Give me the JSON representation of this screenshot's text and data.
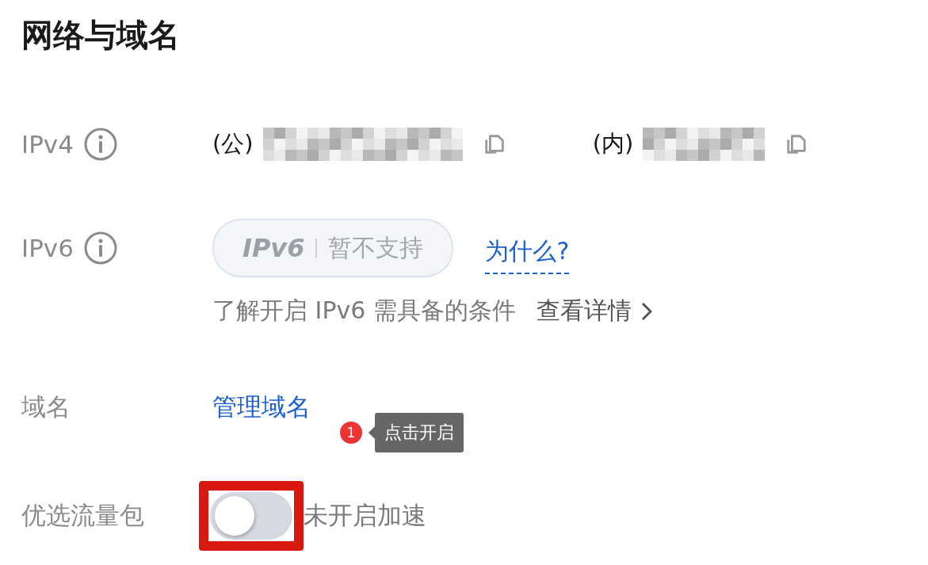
{
  "title": "网络与域名",
  "ipv4": {
    "label": "IPv4",
    "public_prefix": "(公)",
    "private_prefix": "(内)"
  },
  "ipv6": {
    "label": "IPv6",
    "badge_logo": "IPv6",
    "badge_text": "暂不支持",
    "why_link": "为什么?",
    "hint": "了解开启 IPv6 需具备的条件",
    "details_link": "查看详情"
  },
  "domain": {
    "label": "域名",
    "link": "管理域名"
  },
  "traffic": {
    "label": "优选流量包",
    "on": false,
    "highlighted": true,
    "status": "未开启加速",
    "tooltip": {
      "step": "1",
      "text": "点击开启"
    }
  }
}
